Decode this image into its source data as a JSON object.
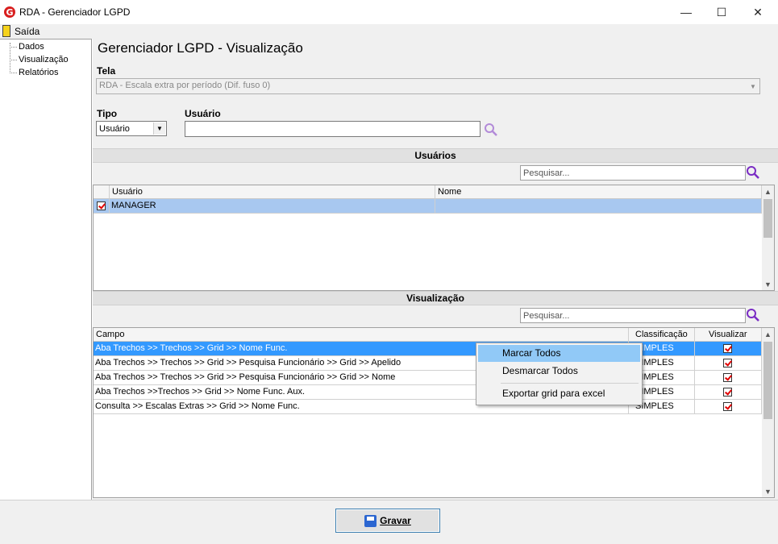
{
  "window": {
    "title": "RDA - Gerenciador LGPD",
    "minimize": "—",
    "maximize": "☐",
    "close": "✕"
  },
  "menu": {
    "exit_label": "Saída"
  },
  "tree": {
    "items": [
      "Dados",
      "Visualização",
      "Relatórios"
    ]
  },
  "page": {
    "title": "Gerenciador LGPD - Visualização"
  },
  "form": {
    "tela_label": "Tela",
    "tela_value": "RDA - Escala extra por período (Dif. fuso 0)",
    "tipo_label": "Tipo",
    "tipo_value": "Usuário",
    "usuario_label": "Usuário",
    "usuario_value": ""
  },
  "users_section": {
    "header": "Usuários",
    "search_placeholder": "Pesquisar...",
    "columns": [
      "Usuário",
      "Nome"
    ],
    "rows": [
      {
        "checked": true,
        "usuario": "MANAGER",
        "nome": ""
      }
    ]
  },
  "view_section": {
    "header": "Visualização",
    "search_placeholder": "Pesquisar...",
    "columns": [
      "Campo",
      "Classificação",
      "Visualizar"
    ],
    "rows": [
      {
        "campo": "Aba Trechos >> Trechos >> Grid >> Nome Func.",
        "classificacao": "SIMPLES",
        "visualizar": true
      },
      {
        "campo": "Aba Trechos >> Trechos >> Grid >> Pesquisa Funcionário >> Grid >> Apelido",
        "classificacao": "SIMPLES",
        "visualizar": true
      },
      {
        "campo": "Aba Trechos >> Trechos >> Grid >> Pesquisa Funcionário >> Grid >> Nome",
        "classificacao": "SIMPLES",
        "visualizar": true
      },
      {
        "campo": "Aba Trechos >>Trechos >> Grid >> Nome Func. Aux.",
        "classificacao": "SIMPLES",
        "visualizar": true
      },
      {
        "campo": "Consulta >> Escalas Extras >> Grid >> Nome Func.",
        "classificacao": "SIMPLES",
        "visualizar": true
      }
    ]
  },
  "context_menu": {
    "items": [
      "Marcar Todos",
      "Desmarcar Todos",
      "Exportar grid para excel"
    ]
  },
  "footer": {
    "save_label": "Gravar"
  },
  "colors": {
    "selection": "#3399ff",
    "menu_highlight": "#91c9f7",
    "search_icon": "#7a2cc4",
    "check": "#e00000"
  }
}
